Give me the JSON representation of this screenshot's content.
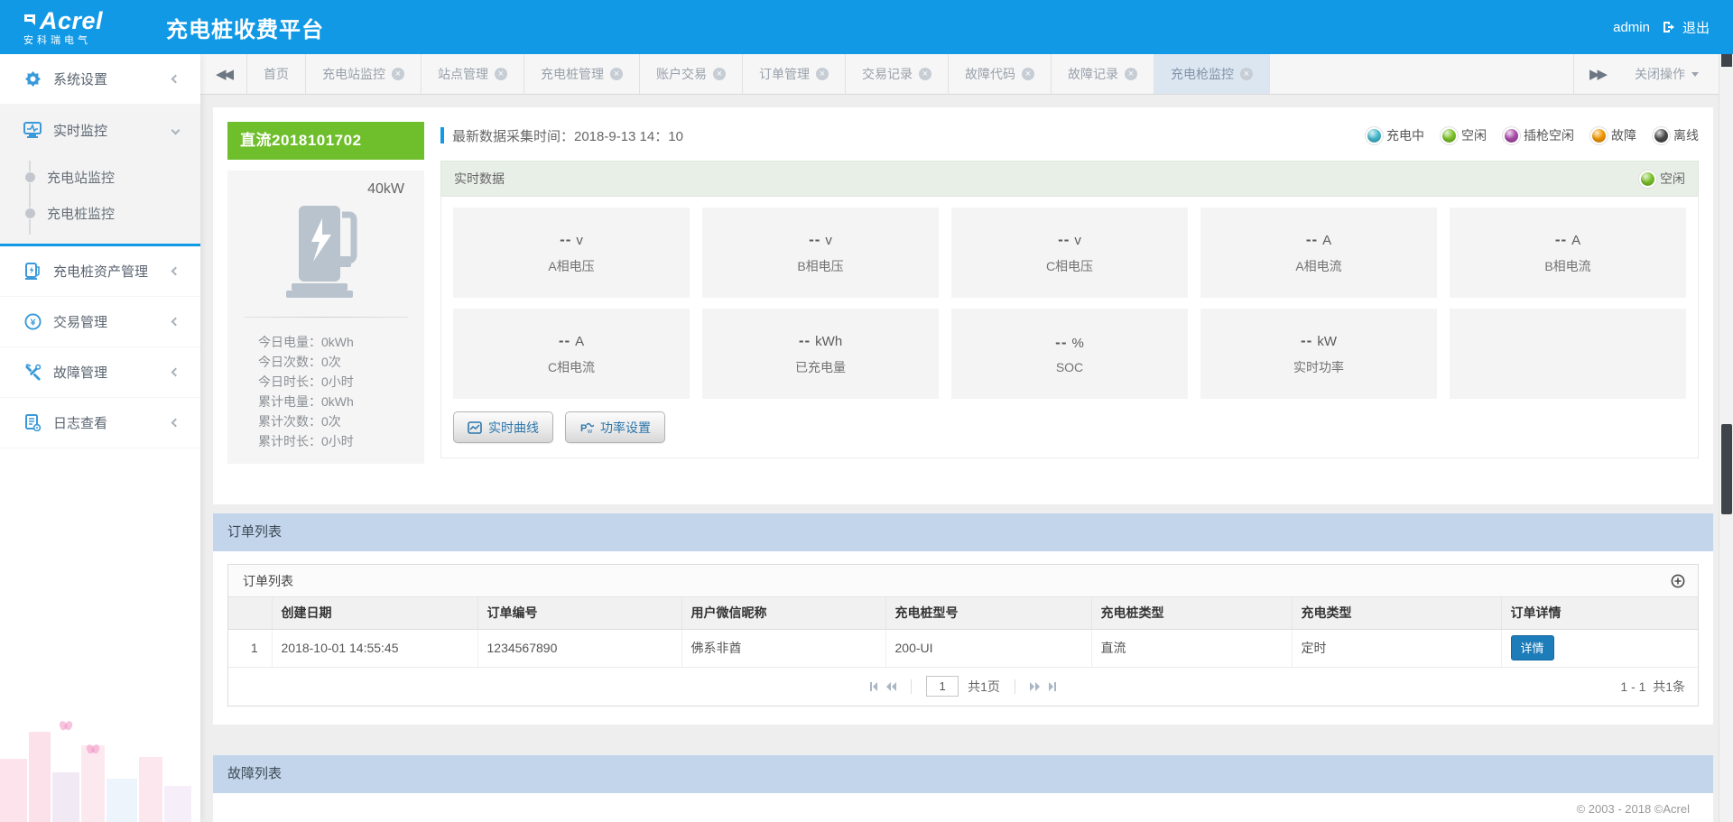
{
  "header": {
    "logo_main": "Acrel",
    "logo_sub": "安科瑞电气",
    "title": "充电桩收费平台",
    "user": "admin",
    "logout_label": "退出",
    "brand_color": "#1199e6"
  },
  "tabbar": {
    "tabs": [
      {
        "label": "首页"
      },
      {
        "label": "充电站监控"
      },
      {
        "label": "站点管理"
      },
      {
        "label": "充电桩管理"
      },
      {
        "label": "账户交易"
      },
      {
        "label": "订单管理"
      },
      {
        "label": "交易记录"
      },
      {
        "label": "故障代码"
      },
      {
        "label": "故障记录"
      },
      {
        "label": "充电枪监控"
      }
    ],
    "active_tab": "充电枪监控",
    "close_ops_label": "关闭操作"
  },
  "sidebar": {
    "items": [
      {
        "label": "系统设置"
      },
      {
        "label": "实时监控",
        "children": [
          {
            "label": "充电站监控"
          },
          {
            "label": "充电桩监控"
          }
        ]
      },
      {
        "label": "充电桩资产管理"
      },
      {
        "label": "交易管理"
      },
      {
        "label": "故障管理"
      },
      {
        "label": "日志查看"
      }
    ]
  },
  "device": {
    "name": "直流2018101702",
    "name_bg_color": "#6fbe2b",
    "power": "40kW",
    "stats": [
      {
        "label": "今日电量：",
        "value": "0kWh"
      },
      {
        "label": "今日次数：",
        "value": "0次"
      },
      {
        "label": "今日时长：",
        "value": "0小时"
      },
      {
        "label": "累计电量：",
        "value": "0kWh"
      },
      {
        "label": "累计次数：",
        "value": "0次"
      },
      {
        "label": "累计时长：",
        "value": "0小时"
      }
    ]
  },
  "monitor": {
    "collect_time": "最新数据采集时间：2018-9-13 14：10",
    "legend": [
      {
        "label": "充电中",
        "color": "#45b8cc"
      },
      {
        "label": "空闲",
        "color": "#7cc32a"
      },
      {
        "label": "插枪空闲",
        "color": "#a94ba9"
      },
      {
        "label": "故障",
        "color": "#f39800"
      },
      {
        "label": "离线",
        "color": "#4a4a4a"
      }
    ],
    "panel_title": "实时数据",
    "status": {
      "label": "空闲",
      "color": "#7cc32a"
    },
    "metrics": [
      {
        "value": "--",
        "unit": "v",
        "label": "A相电压"
      },
      {
        "value": "--",
        "unit": "v",
        "label": "B相电压"
      },
      {
        "value": "--",
        "unit": "v",
        "label": "C相电压"
      },
      {
        "value": "--",
        "unit": "A",
        "label": "A相电流"
      },
      {
        "value": "--",
        "unit": "A",
        "label": "B相电流"
      },
      {
        "value": "--",
        "unit": "A",
        "label": "C相电流"
      },
      {
        "value": "--",
        "unit": "kWh",
        "label": "已充电量"
      },
      {
        "value": "--",
        "unit": "%",
        "label": "SOC"
      },
      {
        "value": "--",
        "unit": "kW",
        "label": "实时功率"
      }
    ],
    "buttons": [
      {
        "label": "实时曲线"
      },
      {
        "label": "功率设置"
      }
    ]
  },
  "orders": {
    "section_title": "订单列表",
    "panel_title": "订单列表",
    "columns": [
      "创建日期",
      "订单编号",
      "用户微信昵称",
      "充电桩型号",
      "充电桩类型",
      "充电类型",
      "订单详情"
    ],
    "rows": [
      {
        "index": "1",
        "created": "2018-10-01 14:55:45",
        "order_no": "1234567890",
        "wechat_nick": "佛系非酋",
        "pile_model": "200-UI",
        "pile_type": "直流",
        "charge_type": "定时",
        "action_label": "详情"
      }
    ],
    "pagination": {
      "page": "1",
      "page_total": "共1页",
      "range": "1 - 1",
      "total": "共1条"
    }
  },
  "faults": {
    "section_title": "故障列表"
  },
  "footer": {
    "copyright": "© 2003 - 2018 ©Acrel"
  }
}
